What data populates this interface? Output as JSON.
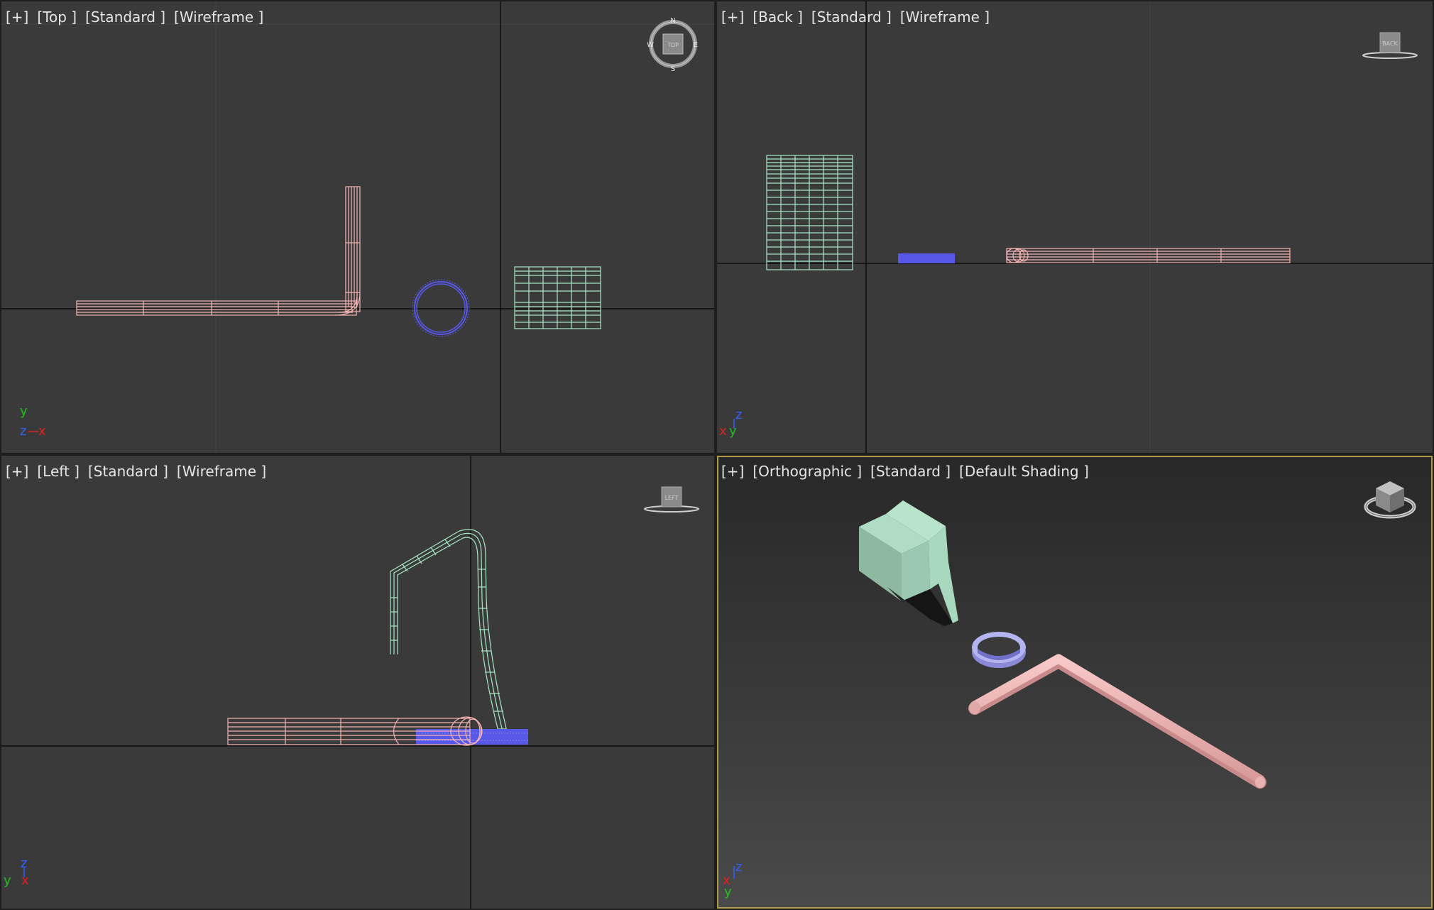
{
  "viewports": {
    "top": {
      "labels": [
        "[+]",
        "[Top ]",
        "[Standard ]",
        "[Wireframe ]"
      ],
      "compass": {
        "n": "N",
        "s": "S",
        "e": "E",
        "w": "W",
        "face": "TOP"
      },
      "axes": {
        "up": "y",
        "depth": "z",
        "right": "x"
      }
    },
    "back": {
      "labels": [
        "[+]",
        "[Back ]",
        "[Standard ]",
        "[Wireframe ]"
      ],
      "cube_face": "BACK",
      "axes": {
        "up": "z",
        "left": "x",
        "right": "y"
      }
    },
    "left": {
      "labels": [
        "[+]",
        "[Left ]",
        "[Standard ]",
        "[Wireframe ]"
      ],
      "cube_face": "LEFT",
      "axes": {
        "up": "z",
        "left": "y",
        "right": "x"
      }
    },
    "orthographic": {
      "labels": [
        "[+]",
        "[Orthographic ]",
        "[Standard ]",
        "[Default Shading ]"
      ],
      "axes": {
        "up": "z",
        "left": "x",
        "down": "y"
      },
      "active": true
    }
  },
  "colors": {
    "pipe": "#f4b4b4",
    "bracket": "#a8e8c8",
    "ring": "#5858e8",
    "active_border": "#b09a4a",
    "axis_x": "#e02020",
    "axis_y": "#20c020",
    "axis_z": "#3060ff"
  }
}
